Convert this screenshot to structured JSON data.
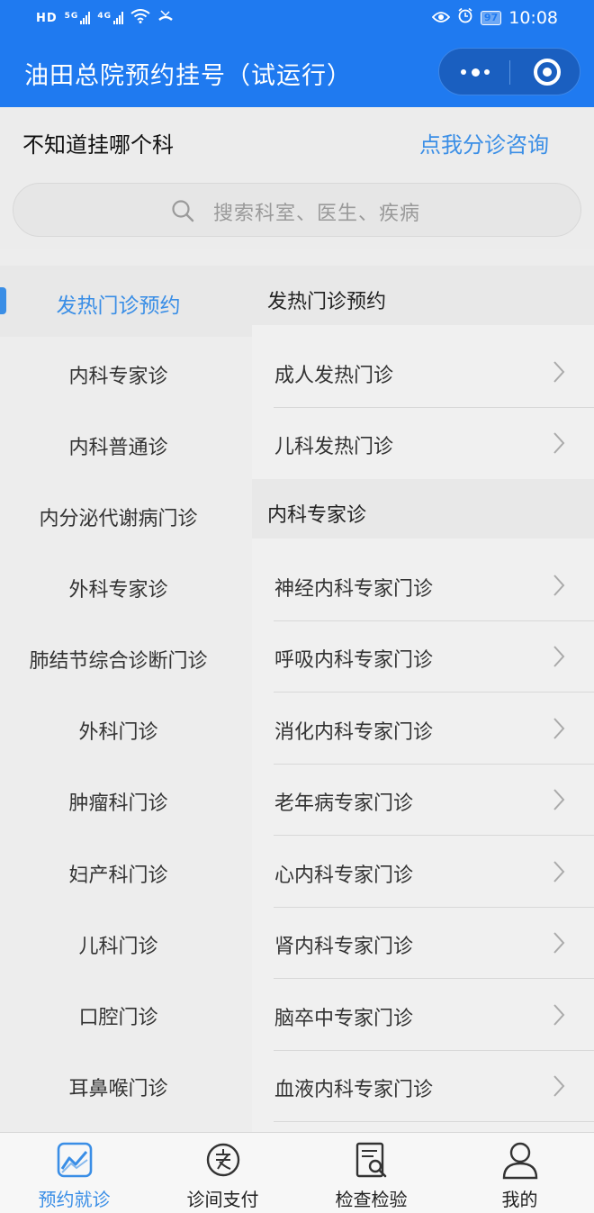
{
  "status_bar": {
    "left_hd": "HD",
    "left_5g": "5G",
    "left_4g": "4G",
    "battery": "97",
    "time": "10:08"
  },
  "header": {
    "title": "油田总院预约挂号（试运行）"
  },
  "triage": {
    "question": "不知道挂哪个科",
    "link": "点我分诊咨询"
  },
  "search": {
    "placeholder": "搜索科室、医生、疾病"
  },
  "departments": [
    {
      "label": "发热门诊预约",
      "active": true
    },
    {
      "label": "内科专家诊"
    },
    {
      "label": "内科普通诊"
    },
    {
      "label": "内分泌代谢病门诊"
    },
    {
      "label": "外科专家诊"
    },
    {
      "label": "肺结节综合诊断门诊"
    },
    {
      "label": "外科门诊"
    },
    {
      "label": "肿瘤科门诊"
    },
    {
      "label": "妇产科门诊"
    },
    {
      "label": "儿科门诊"
    },
    {
      "label": "口腔门诊"
    },
    {
      "label": "耳鼻喉门诊"
    }
  ],
  "sections": [
    {
      "title": "发热门诊预约",
      "items": [
        "成人发热门诊",
        "儿科发热门诊"
      ]
    },
    {
      "title": "内科专家诊",
      "items": [
        "神经内科专家门诊",
        "呼吸内科专家门诊",
        "消化内科专家门诊",
        "老年病专家门诊",
        "心内科专家门诊",
        "肾内科专家门诊",
        "脑卒中专家门诊",
        "血液内科专家门诊"
      ]
    }
  ],
  "tabbar": [
    {
      "label": "预约就诊",
      "icon": "chart-icon",
      "active": true
    },
    {
      "label": "诊间支付",
      "icon": "pay-icon"
    },
    {
      "label": "检查检验",
      "icon": "report-search-icon"
    },
    {
      "label": "我的",
      "icon": "user-icon"
    }
  ],
  "colors": {
    "header": "#1f7af0",
    "accent": "#3a8ee6"
  }
}
